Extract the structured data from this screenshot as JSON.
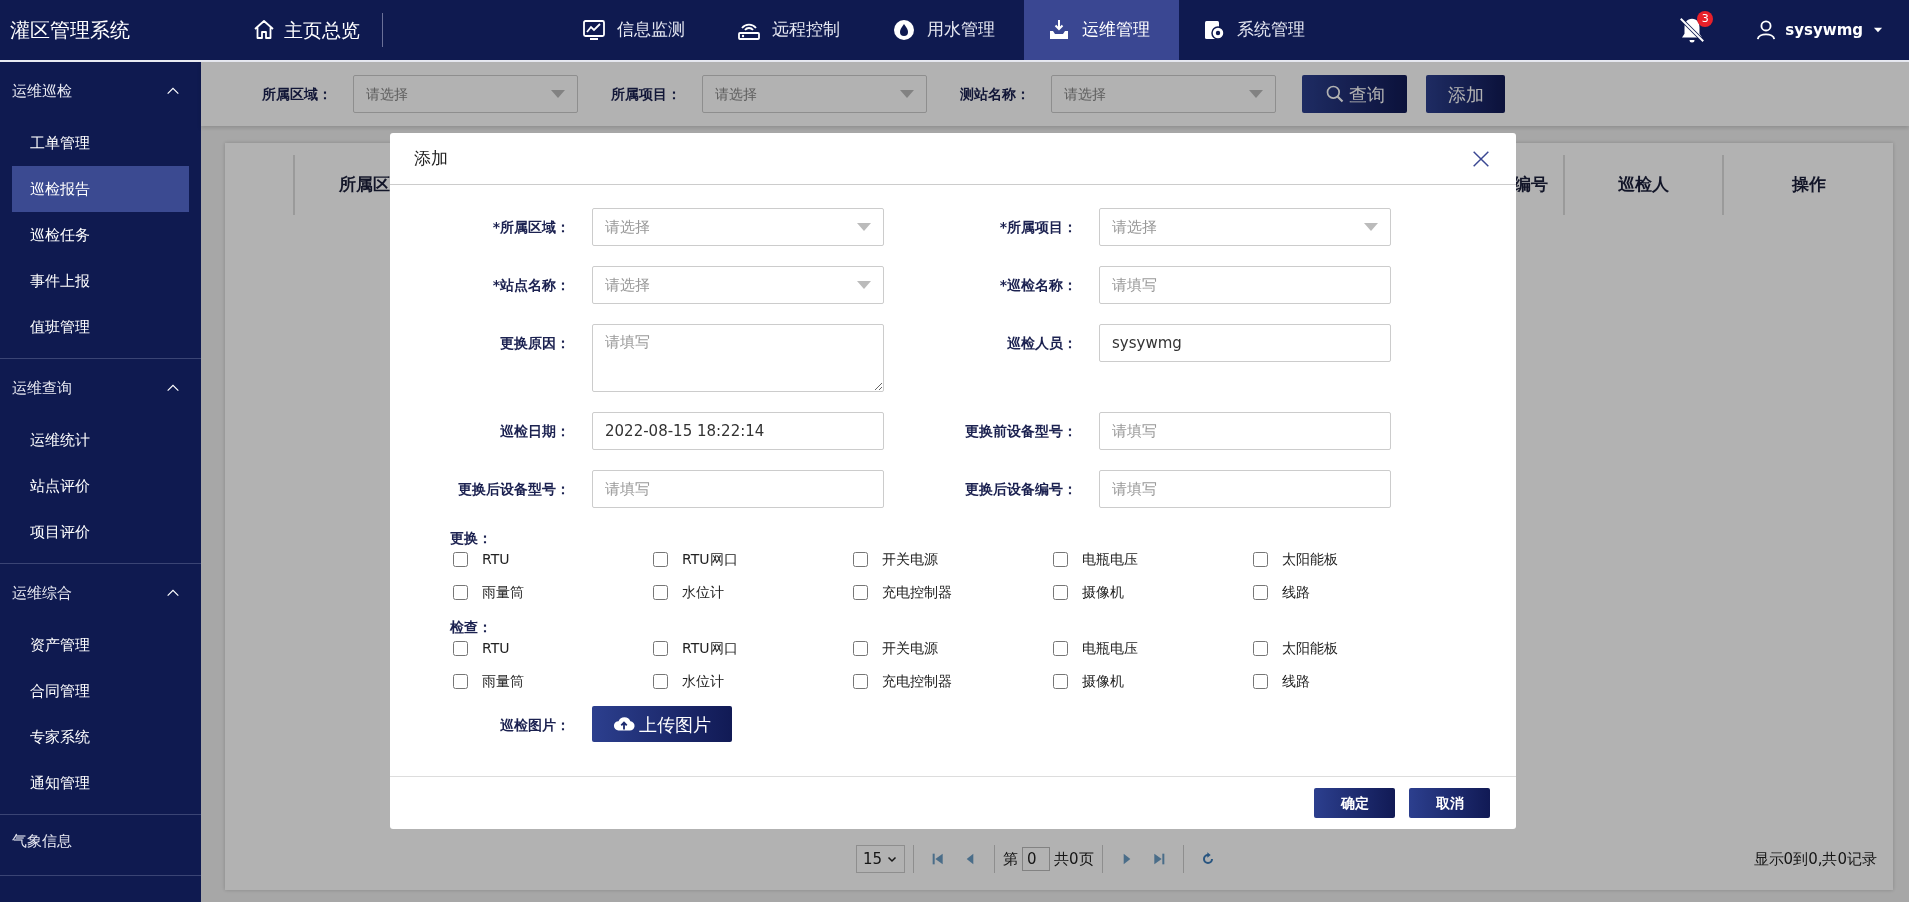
{
  "app_title": "灌区管理系统",
  "home": {
    "label": "主页总览"
  },
  "nav": [
    {
      "label": "信息监测",
      "selected": false
    },
    {
      "label": "远程控制",
      "selected": false
    },
    {
      "label": "用水管理",
      "selected": false
    },
    {
      "label": "运维管理",
      "selected": true
    },
    {
      "label": "系统管理",
      "selected": false
    }
  ],
  "notifications": {
    "count": "3"
  },
  "user": {
    "name": "sysywmg"
  },
  "sidebar": {
    "groups": [
      {
        "label": "运维巡检",
        "kind": "group",
        "expanded": true,
        "children": [
          {
            "label": "工单管理",
            "selected": false
          },
          {
            "label": "巡检报告",
            "selected": true
          },
          {
            "label": "巡检任务",
            "selected": false
          },
          {
            "label": "事件上报",
            "selected": false
          },
          {
            "label": "值班管理",
            "selected": false
          }
        ]
      },
      {
        "label": "运维查询",
        "kind": "group",
        "expanded": true,
        "children": [
          {
            "label": "运维统计",
            "selected": false
          },
          {
            "label": "站点评价",
            "selected": false
          },
          {
            "label": "项目评价",
            "selected": false
          }
        ]
      },
      {
        "label": "运维综合",
        "kind": "group",
        "expanded": true,
        "children": [
          {
            "label": "资产管理",
            "selected": false
          },
          {
            "label": "合同管理",
            "selected": false
          },
          {
            "label": "专家系统",
            "selected": false
          },
          {
            "label": "通知管理",
            "selected": false
          }
        ]
      },
      {
        "label": "气象信息",
        "kind": "link"
      }
    ]
  },
  "filters": [
    {
      "label": "所属区域：",
      "placeholder": "请选择"
    },
    {
      "label": "所属项目：",
      "placeholder": "请选择"
    },
    {
      "label": "测站名称：",
      "placeholder": "请选择"
    }
  ],
  "filter_buttons": [
    {
      "label": "查询",
      "kind": "search"
    },
    {
      "label": "添加",
      "kind": "plain"
    }
  ],
  "table": {
    "columns": [
      "所属区",
      "编号",
      "巡检人",
      "操作"
    ]
  },
  "pagination": {
    "page_size": "15",
    "page_before": "第",
    "page": "0",
    "page_after": "共0页",
    "summary": "显示0到0,共0记录"
  },
  "dialog": {
    "title": "添加",
    "fields": [
      {
        "label": "*所属区域：",
        "kind": "select",
        "placeholder": "请选择"
      },
      {
        "label": "*所属项目：",
        "kind": "select",
        "placeholder": "请选择"
      },
      {
        "label": "*站点名称：",
        "kind": "select",
        "placeholder": "请选择"
      },
      {
        "label": "*巡检名称：",
        "kind": "text",
        "placeholder": "请填写"
      },
      {
        "label": "更换原因：",
        "kind": "textarea",
        "placeholder": "请填写"
      },
      {
        "label": "巡检人员：",
        "kind": "text",
        "value": "sysywmg"
      },
      {
        "label": "巡检日期：",
        "kind": "text",
        "value": "2022-08-15 18:22:14"
      },
      {
        "label": "更换前设备型号：",
        "kind": "text",
        "placeholder": "请填写"
      },
      {
        "label": "更换后设备型号：",
        "kind": "text",
        "placeholder": "请填写"
      },
      {
        "label": "更换后设备编号：",
        "kind": "text",
        "placeholder": "请填写"
      }
    ],
    "checkbox_groups": [
      {
        "label": "更换：",
        "items": [
          {
            "label": "RTU",
            "checked": false
          },
          {
            "label": "RTU网口",
            "checked": false
          },
          {
            "label": "开关电源",
            "checked": false
          },
          {
            "label": "电瓶电压",
            "checked": false
          },
          {
            "label": "太阳能板",
            "checked": false
          },
          {
            "label": "雨量筒",
            "checked": false
          },
          {
            "label": "水位计",
            "checked": false
          },
          {
            "label": "充电控制器",
            "checked": false
          },
          {
            "label": "摄像机",
            "checked": false
          },
          {
            "label": "线路",
            "checked": false
          }
        ]
      },
      {
        "label": "检查：",
        "items": [
          {
            "label": "RTU",
            "checked": false
          },
          {
            "label": "RTU网口",
            "checked": false
          },
          {
            "label": "开关电源",
            "checked": false
          },
          {
            "label": "电瓶电压",
            "checked": false
          },
          {
            "label": "太阳能板",
            "checked": false
          },
          {
            "label": "雨量筒",
            "checked": false
          },
          {
            "label": "水位计",
            "checked": false
          },
          {
            "label": "充电控制器",
            "checked": false
          },
          {
            "label": "摄像机",
            "checked": false
          },
          {
            "label": "线路",
            "checked": false
          }
        ]
      }
    ],
    "upload": {
      "label": "巡检图片：",
      "button": "上传图片"
    },
    "buttons": [
      {
        "label": "确定"
      },
      {
        "label": "取消"
      }
    ]
  }
}
